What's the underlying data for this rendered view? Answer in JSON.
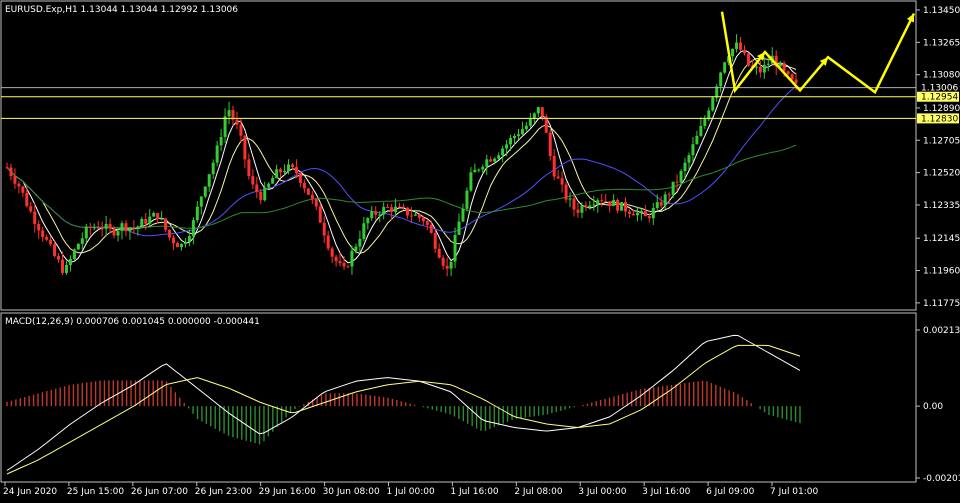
{
  "colors": {
    "background": "#000000",
    "frame": "#c0c0c0",
    "bull": "#32cd32",
    "bear": "#ff3030",
    "ma_fast": "#ffffff",
    "ma_mid": "#f5f5a0",
    "ma_slow_blue": "#5050ff",
    "ma_slow_green": "#2e8b2e",
    "level": "#ffff66",
    "arrow": "#ffff00",
    "macd_line": "#ffffff",
    "signal_line": "#ffff80",
    "hist_pos": "#c0392b",
    "hist_neg": "#2e8b2e"
  },
  "main_header": "EURUSD.Exp,H1  1.13044 1.13044 1.12992 1.13006",
  "macd_header": "MACD(12,26,9) 0.000706 0.001045 0.000000 -0.000441",
  "price_labels": {
    "current": "1.13006",
    "level_1": "1.12954",
    "level_2": "1.12830"
  },
  "chart_data": [
    {
      "type": "candlestick",
      "symbol": "EURUSD.Exp",
      "timeframe": "H1",
      "ohlc_header": {
        "open": 1.13044,
        "high": 1.13044,
        "low": 1.12992,
        "close": 1.13006
      },
      "y_ticks": [
        "1.13450",
        "1.13265",
        "1.13080",
        "1.12890",
        "1.12705",
        "1.12520",
        "1.12335",
        "1.12145",
        "1.11960",
        "1.11775"
      ],
      "ylim": [
        1.1174,
        1.1349
      ],
      "x_ticks": [
        "24 Jun 2020",
        "25 Jun 15:00",
        "26 Jun 07:00",
        "26 Jun 23:00",
        "29 Jun 16:00",
        "30 Jun 08:00",
        "1 Jul 00:00",
        "1 Jul 16:00",
        "2 Jul 08:00",
        "3 Jul 00:00",
        "3 Jul 16:00",
        "6 Jul 09:00",
        "7 Jul 01:00"
      ],
      "close_path": [
        1.1255,
        1.1245,
        1.123,
        1.1218,
        1.1205,
        1.1195,
        1.121,
        1.122,
        1.1222,
        1.1218,
        1.1222,
        1.122,
        1.1225,
        1.1228,
        1.1215,
        1.121,
        1.1222,
        1.1245,
        1.1262,
        1.129,
        1.1275,
        1.1245,
        1.1238,
        1.125,
        1.1255,
        1.1252,
        1.124,
        1.1225,
        1.1205,
        1.1195,
        1.121,
        1.1225,
        1.123,
        1.1232,
        1.123,
        1.1228,
        1.1225,
        1.121,
        1.1195,
        1.1225,
        1.125,
        1.1258,
        1.1262,
        1.1268,
        1.1275,
        1.128,
        1.129,
        1.1255,
        1.124,
        1.123,
        1.1235,
        1.1238,
        1.1235,
        1.1232,
        1.123,
        1.1226,
        1.1232,
        1.124,
        1.125,
        1.1265,
        1.128,
        1.13,
        1.132,
        1.1325,
        1.1312,
        1.131,
        1.1318,
        1.1308,
        1.1301
      ],
      "levels": [
        1.13006,
        1.12954,
        1.1283
      ],
      "projection": [
        1.1299,
        1.1312,
        1.1298,
        1.1343
      ]
    },
    {
      "type": "macd",
      "params": [
        12,
        26,
        9
      ],
      "values": {
        "main": 0.000706,
        "signal": 0.001045,
        "third": 0.0,
        "histogram": -0.000441
      },
      "y_ticks": [
        "0.002131",
        "0.00",
        "-0.002011"
      ],
      "ylim": [
        -0.002011,
        0.002131
      ],
      "macd_path": [
        -0.0018,
        -0.0012,
        -0.0005,
        0.0001,
        0.0006,
        0.0012,
        0.0005,
        -0.0002,
        -0.0008,
        -0.0003,
        0.0004,
        0.0007,
        0.0008,
        0.0007,
        0.0004,
        -0.0004,
        -0.0006,
        -0.0007,
        -0.0006,
        -0.0003,
        0.0003,
        0.001,
        0.0018,
        0.002,
        0.0015,
        0.001
      ],
      "signal_path": [
        -0.0019,
        -0.0015,
        -0.001,
        -0.0005,
        -0.0,
        0.0006,
        0.0008,
        0.0005,
        0.0001,
        -0.0002,
        0.0001,
        0.0004,
        0.0006,
        0.0007,
        0.0006,
        0.0002,
        -0.0003,
        -0.0005,
        -0.0006,
        -0.0005,
        -0.0001,
        0.0005,
        0.0012,
        0.0017,
        0.0017,
        0.0014
      ]
    }
  ]
}
